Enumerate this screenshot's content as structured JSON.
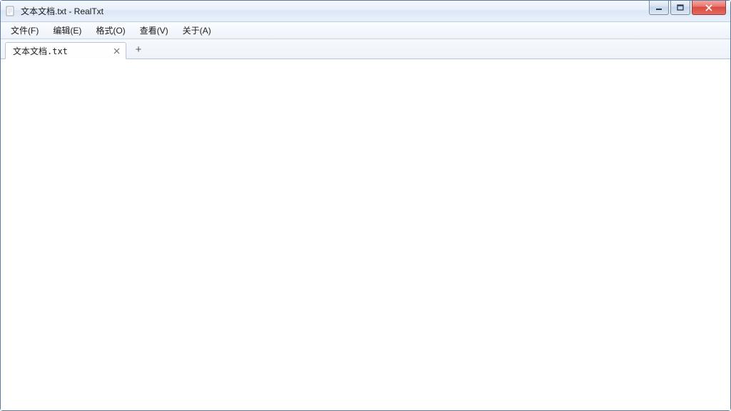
{
  "window": {
    "title": "文本文档.txt - RealTxt"
  },
  "menu": {
    "items": [
      {
        "label": "文件(F)"
      },
      {
        "label": "编辑(E)"
      },
      {
        "label": "格式(O)"
      },
      {
        "label": "查看(V)"
      },
      {
        "label": "关于(A)"
      }
    ]
  },
  "tabs": {
    "items": [
      {
        "label": "文本文档.txt"
      }
    ],
    "new_tab_symbol": "+"
  },
  "editor": {
    "content": ""
  }
}
